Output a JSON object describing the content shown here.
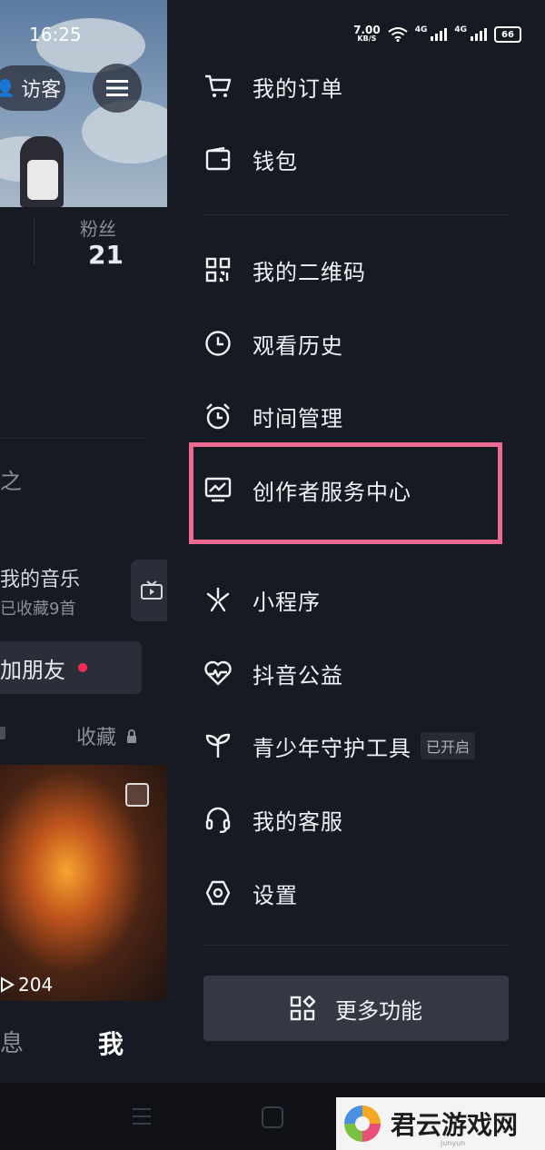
{
  "status_bar": {
    "time": "16:25",
    "net_speed": "7.00",
    "net_unit": "KB/S",
    "net_type_1": "4G",
    "net_type_2": "4G",
    "battery": "66"
  },
  "profile_bg": {
    "visitor_label": "访客",
    "fans_label": "粉丝",
    "fans_count": "21",
    "partial_glyph": "之",
    "music_title": "我的音乐",
    "music_sub": "已收藏9首",
    "add_friend_label": "加朋友",
    "collect_label": "收藏",
    "play_count": "204",
    "tab_messages": "息",
    "tab_me": "我"
  },
  "drawer": {
    "items": [
      {
        "label": "我的订单",
        "icon": "cart-icon"
      },
      {
        "label": "钱包",
        "icon": "wallet-icon"
      },
      {
        "label": "我的二维码",
        "icon": "qrcode-icon"
      },
      {
        "label": "观看历史",
        "icon": "clock-icon"
      },
      {
        "label": "时间管理",
        "icon": "alarm-icon"
      },
      {
        "label": "创作者服务中心",
        "icon": "chart-icon"
      },
      {
        "label": "小程序",
        "icon": "mini-program-icon"
      },
      {
        "label": "抖音公益",
        "icon": "heart-icon"
      },
      {
        "label": "青少年守护工具",
        "icon": "sprout-icon",
        "badge": "已开启"
      },
      {
        "label": "我的客服",
        "icon": "headset-icon"
      },
      {
        "label": "设置",
        "icon": "settings-icon"
      }
    ],
    "more_label": "更多功能"
  },
  "watermark": {
    "text": "君云游戏网",
    "sub": "junyun"
  },
  "colors": {
    "highlight": "#ef6a91",
    "accent_red": "#fe2c55",
    "drawer_bg": "#161a22"
  }
}
